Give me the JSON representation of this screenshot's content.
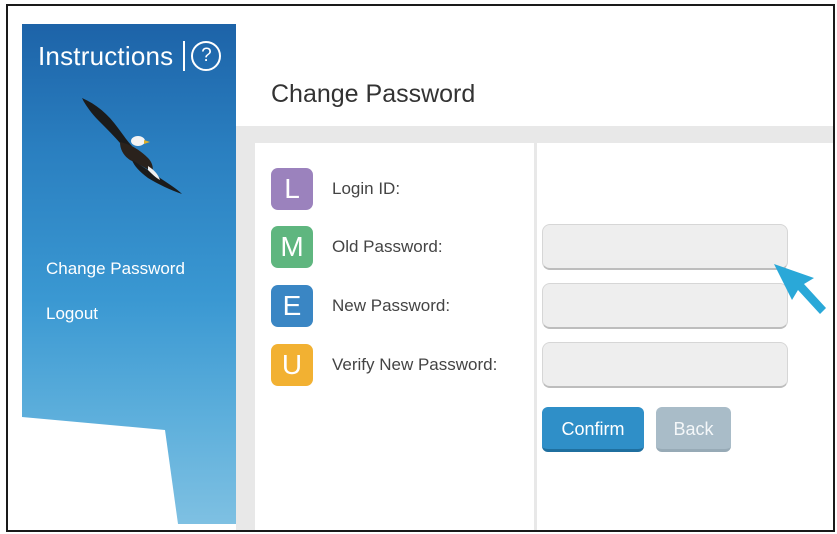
{
  "sidebar": {
    "title": "Instructions",
    "help_icon": "?",
    "nav": [
      {
        "label": "Change Password"
      },
      {
        "label": "Logout"
      }
    ]
  },
  "page": {
    "title": "Change Password"
  },
  "form": {
    "rows": [
      {
        "letter": "L",
        "label": "Login ID:",
        "color": "#9b82bd"
      },
      {
        "letter": "M",
        "label": "Old Password:",
        "color": "#5fb67f"
      },
      {
        "letter": "E",
        "label": "New Password:",
        "color": "#3a86c4"
      },
      {
        "letter": "U",
        "label": "Verify New Password:",
        "color": "#f2b132"
      }
    ],
    "fields": [
      {
        "value": ""
      },
      {
        "value": ""
      },
      {
        "value": ""
      }
    ],
    "confirm_label": "Confirm",
    "back_label": "Back"
  },
  "colors": {
    "sidebar_top": "#1d63a8",
    "sidebar_bottom": "#7ec0e2",
    "confirm": "#2f8fc8",
    "back": "#a9bcc8",
    "cursor": "#2aa8d8"
  }
}
